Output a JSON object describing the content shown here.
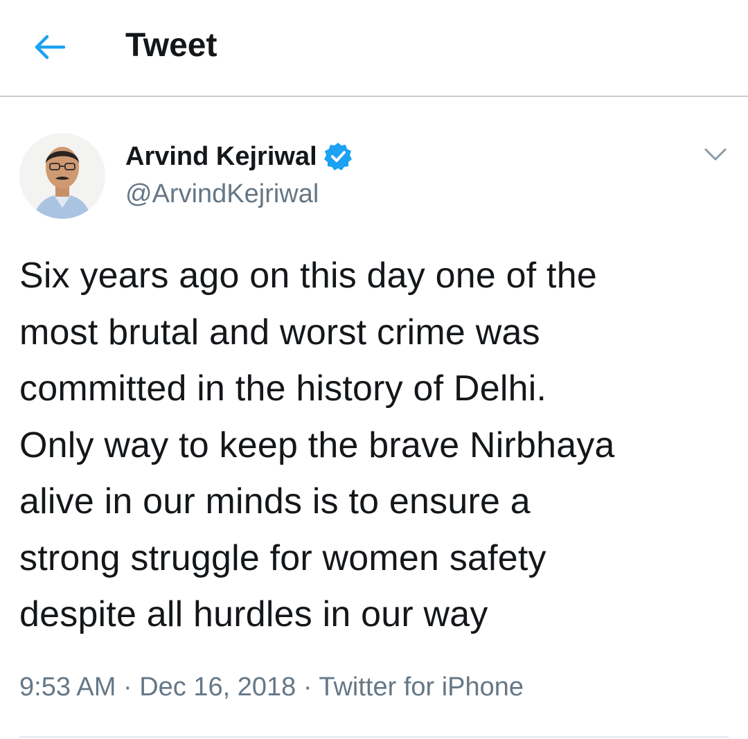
{
  "header": {
    "back_icon": "back-arrow-icon",
    "title": "Tweet",
    "accent_color": "#1da1f2"
  },
  "author": {
    "name": "Arvind Kejriwal",
    "handle": "@ArvindKejriwal",
    "verified_icon": "verified-badge-icon",
    "menu_icon": "chevron-down-icon"
  },
  "tweet": {
    "text": "Six years ago on this day one of the\nmost brutal and worst crime was\ncommitted in the history of Delhi.\nOnly way to keep the brave Nirbhaya\nalive in our minds is to ensure a\nstrong struggle for women safety\ndespite all hurdles in our way"
  },
  "meta": {
    "time": "9:53 AM",
    "separator": " · ",
    "date": "Dec 16, 2018",
    "source": "Twitter for iPhone"
  }
}
